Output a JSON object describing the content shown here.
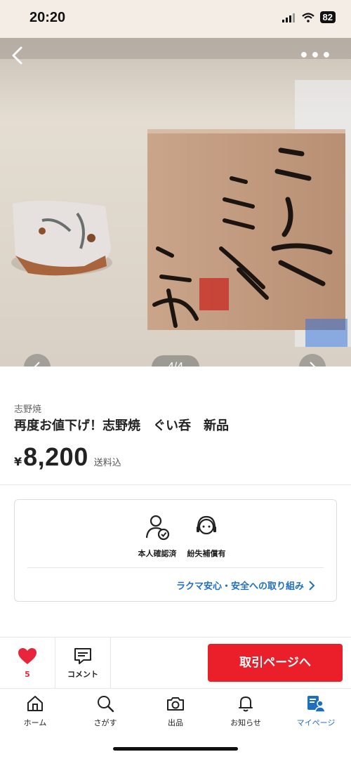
{
  "status": {
    "time": "20:20",
    "battery": "82"
  },
  "gallery": {
    "counter": "4/4"
  },
  "item": {
    "category": "志野焼",
    "title": "再度お値下げ！志野焼　ぐい呑　新品",
    "currency": "¥",
    "price": "8,200",
    "shipping": "送料込"
  },
  "trust": {
    "features": [
      "本人確認済",
      "紛失補償有"
    ],
    "link": "ラクマ安心・安全への取り組み"
  },
  "actions": {
    "likes": "5",
    "comment_label": "コメント",
    "trade_button": "取引ページへ"
  },
  "tabs": [
    {
      "label": "ホーム",
      "icon": "home-icon"
    },
    {
      "label": "さがす",
      "icon": "search-icon"
    },
    {
      "label": "出品",
      "icon": "camera-icon"
    },
    {
      "label": "お知らせ",
      "icon": "bell-icon"
    },
    {
      "label": "マイページ",
      "icon": "mypage-icon",
      "active": true
    }
  ],
  "colors": {
    "accent_red": "#ea1f29",
    "link_blue": "#1f6fc1",
    "heart": "#e8263b"
  }
}
